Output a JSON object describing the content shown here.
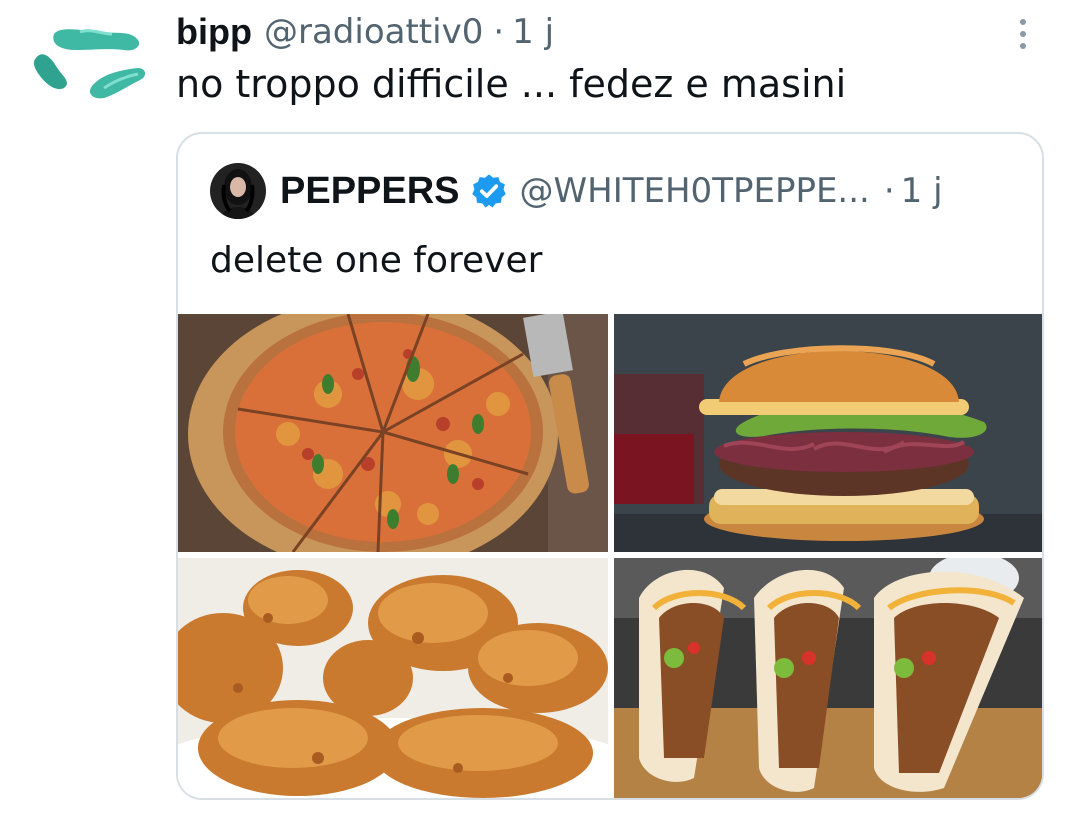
{
  "author": {
    "display_name": "bipp",
    "handle": "@radioattiv0",
    "separator": "·",
    "time": "1 j",
    "text": "no troppo difficile ... fedez e masini",
    "avatar_icon": "teal-gummy-candy-avatar-icon"
  },
  "more_icon": "three-dots-vertical-icon",
  "quote": {
    "display_name": "PEPPERS",
    "verified_icon": "verified-badge-icon",
    "handle": "@WHITEH0TPEPPE...",
    "separator": "·",
    "time": "1 j",
    "text": "delete one forever",
    "media": [
      {
        "subject": "pizza"
      },
      {
        "subject": "burger"
      },
      {
        "subject": "fried chicken"
      },
      {
        "subject": "tacos"
      }
    ]
  },
  "colors": {
    "text_primary": "#0f1419",
    "text_secondary": "#536471",
    "verified_blue": "#1d9bf0",
    "border": "#d8dfe4",
    "avatar_teal": "#3fb8a4"
  }
}
